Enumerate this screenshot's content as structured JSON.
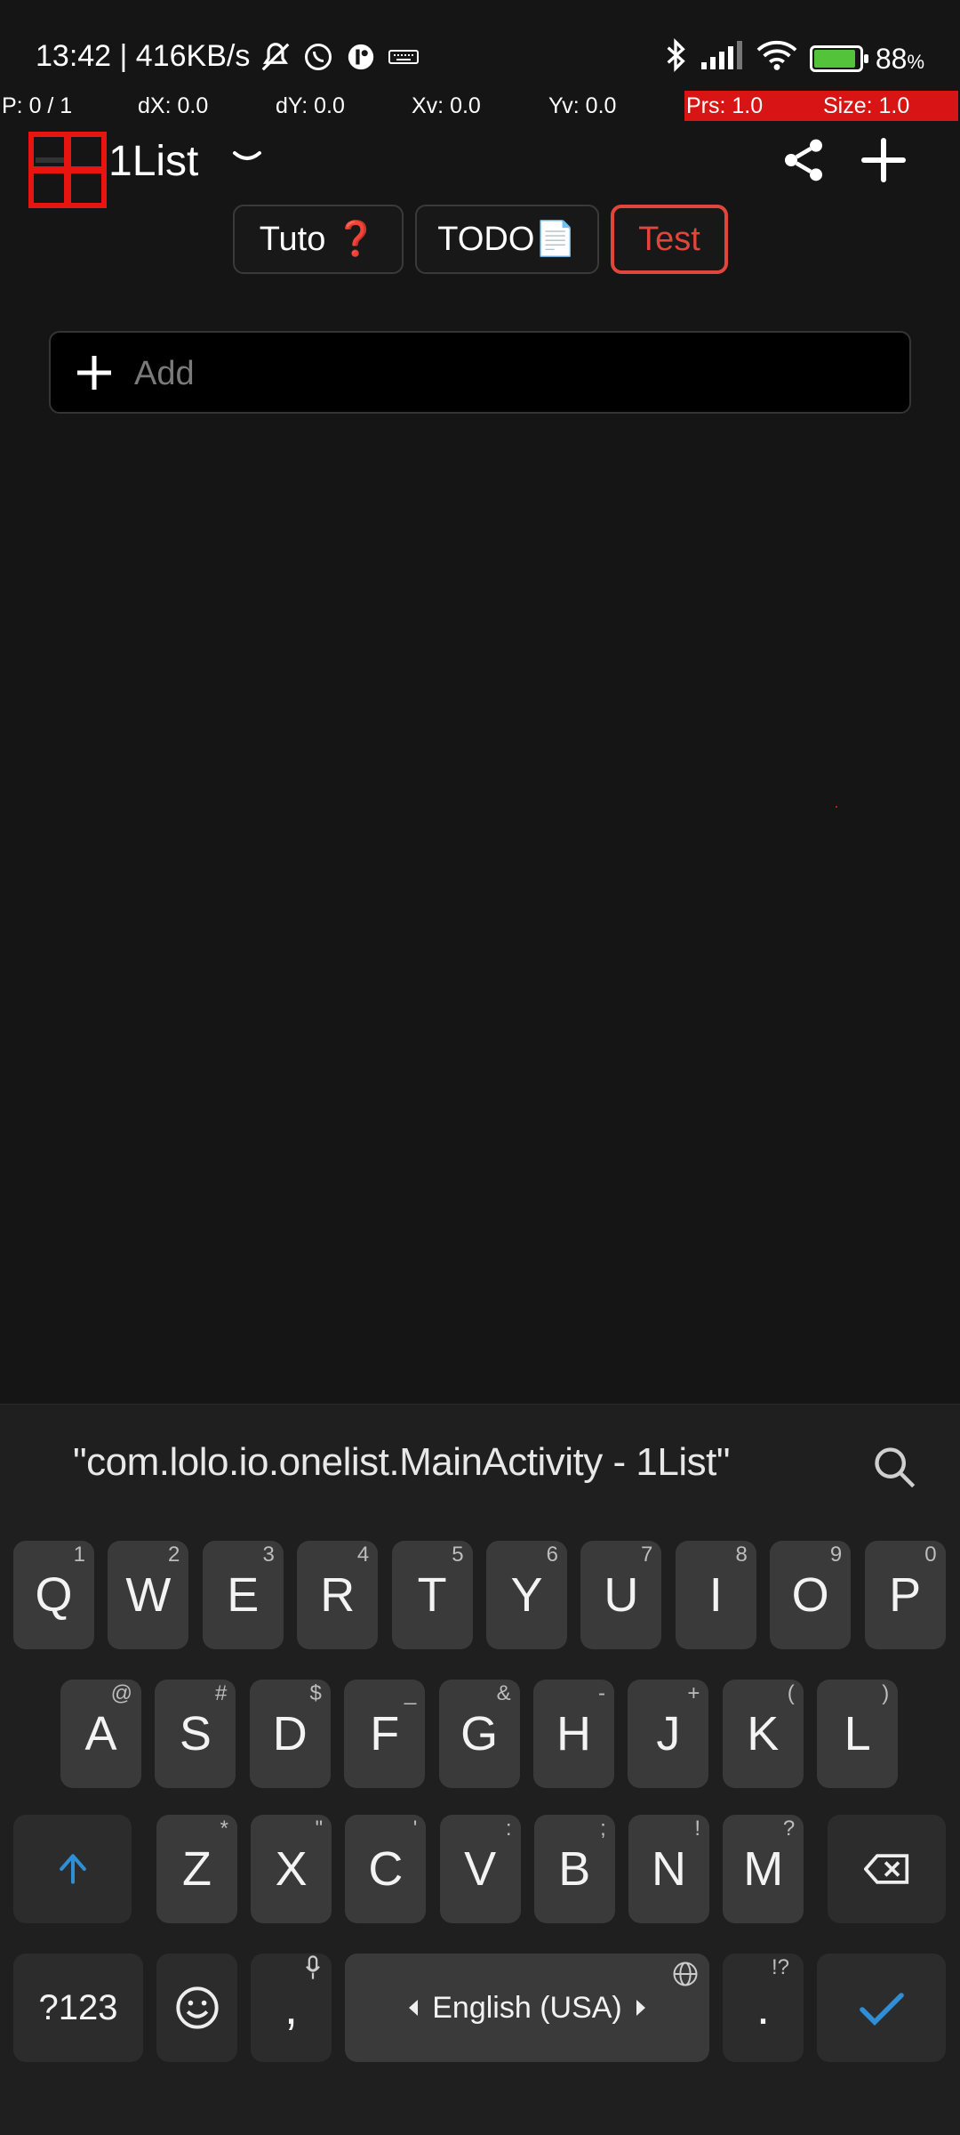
{
  "status_bar": {
    "time_speed": "13:42 | 416KB/s",
    "battery_percent": "88",
    "battery_symbol": "%",
    "battery_level": 0.88,
    "battery_color": "#53c43a",
    "icons": [
      "mute-icon",
      "whatsapp-icon",
      "app-icon",
      "keyboard-icon",
      "bluetooth-icon",
      "signal-icon",
      "wifi-icon",
      "battery-icon"
    ]
  },
  "pointer_overlay": {
    "p": "P: 0 / 1",
    "dx": "dX: 0.0",
    "dy": "dY: 0.0",
    "xv": "Xv: 0.0",
    "yv": "Yv: 0.0",
    "prs": "Prs: 1.0",
    "size": "Size: 1.0",
    "highlight_color": "#d81414"
  },
  "app_bar": {
    "title": "1List",
    "icons": [
      "app-logo-icon",
      "chevron-down-icon",
      "share-icon",
      "plus-icon"
    ]
  },
  "tabs": [
    {
      "label": "Tuto ❓"
    },
    {
      "label": "TODO📄"
    },
    {
      "label": "Test",
      "active": true
    }
  ],
  "add_input": {
    "placeholder": "Add",
    "value": ""
  },
  "keyboard": {
    "suggestion": "\"com.lolo.io.onelist.MainActivity - 1List\"",
    "row1": [
      {
        "k": "Q",
        "s": "1"
      },
      {
        "k": "W",
        "s": "2"
      },
      {
        "k": "E",
        "s": "3"
      },
      {
        "k": "R",
        "s": "4"
      },
      {
        "k": "T",
        "s": "5"
      },
      {
        "k": "Y",
        "s": "6"
      },
      {
        "k": "U",
        "s": "7"
      },
      {
        "k": "I",
        "s": "8"
      },
      {
        "k": "O",
        "s": "9"
      },
      {
        "k": "P",
        "s": "0"
      }
    ],
    "row2": [
      {
        "k": "A",
        "s": "@"
      },
      {
        "k": "S",
        "s": "#"
      },
      {
        "k": "D",
        "s": "$"
      },
      {
        "k": "F",
        "s": "_"
      },
      {
        "k": "G",
        "s": "&"
      },
      {
        "k": "H",
        "s": "-"
      },
      {
        "k": "J",
        "s": "+"
      },
      {
        "k": "K",
        "s": "("
      },
      {
        "k": "L",
        "s": ")"
      }
    ],
    "row3": [
      {
        "k": "Z",
        "s": "*"
      },
      {
        "k": "X",
        "s": "\""
      },
      {
        "k": "C",
        "s": "'"
      },
      {
        "k": "V",
        "s": ":"
      },
      {
        "k": "B",
        "s": ";"
      },
      {
        "k": "N",
        "s": "!"
      },
      {
        "k": "M",
        "s": "?"
      }
    ],
    "symbols_label": "?123",
    "comma": ",",
    "space_label": "English (USA)",
    "period": ".",
    "period_sup": "!?",
    "accent_color": "#2f8fd6"
  }
}
